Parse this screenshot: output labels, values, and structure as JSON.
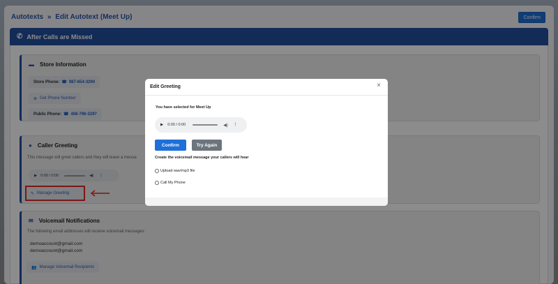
{
  "breadcrumb": {
    "parent": "Autotexts",
    "separator": "»",
    "current": "Edit Autotext (Meet Up)"
  },
  "top_confirm_label": "Confirm",
  "section": {
    "title": "After Calls are Missed",
    "icon": "phone-missed-icon"
  },
  "store_info": {
    "title": "Store Information",
    "store_phone_label": "Store Phone:",
    "store_phone": "987-654-3290",
    "get_phone_label": "Get Phone Number",
    "public_phone_label": "Public Phone:",
    "public_phone": "406-796-3297"
  },
  "caller_greeting": {
    "title": "Caller Greeting",
    "description": "This message will greet callers and they will leave a messa",
    "audio_time": "0:00 / 0:00",
    "manage_label": "Manage Greeting"
  },
  "voicemail": {
    "title": "Voicemail Notifications",
    "description": "The following email addresses will receive voicemail messages:",
    "emails": [
      "demoaccount@gmail.com",
      "demoaccount@gmail.com"
    ],
    "manage_label": "Manage Voicemail Recipients"
  },
  "modal": {
    "title": "Edit Greeting",
    "close_glyph": "×",
    "selected_text": "You have selected for Meet Up",
    "audio_time": "0:00 / 0:00",
    "confirm_label": "Confirm",
    "retry_label": "Try Again",
    "instruction": "Create the voicemail message your callers will hear",
    "option_upload": "Upload wav/mp3 file",
    "option_call": "Call My Phone"
  },
  "colors": {
    "primary": "#1f6fd8",
    "header": "#214f9e",
    "highlight": "#e02a2a"
  }
}
